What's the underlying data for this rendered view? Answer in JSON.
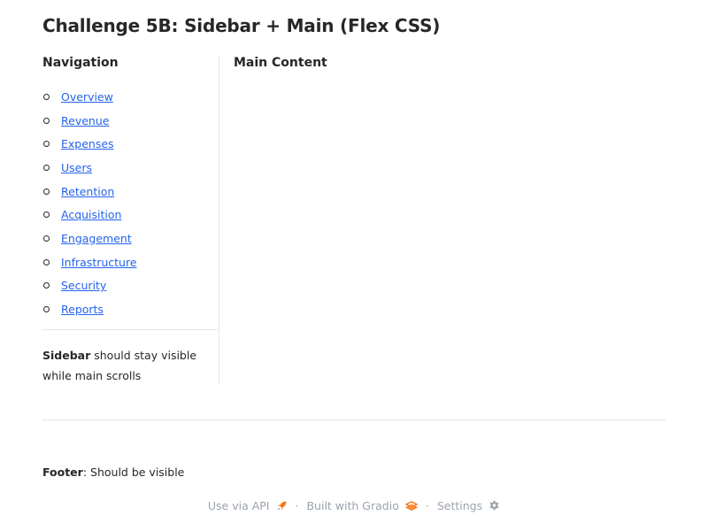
{
  "page": {
    "title": "Challenge 5B: Sidebar + Main (Flex CSS)"
  },
  "sidebar": {
    "heading": "Navigation",
    "items": [
      {
        "label": "Overview"
      },
      {
        "label": "Revenue"
      },
      {
        "label": "Expenses"
      },
      {
        "label": "Users"
      },
      {
        "label": "Retention"
      },
      {
        "label": "Acquisition"
      },
      {
        "label": "Engagement"
      },
      {
        "label": "Infrastructure"
      },
      {
        "label": "Security"
      },
      {
        "label": "Reports"
      }
    ],
    "note_bold": "Sidebar",
    "note_rest": " should stay visible while main scrolls"
  },
  "main": {
    "heading": "Main Content"
  },
  "footer": {
    "note_bold": "Footer",
    "note_rest": ": Should be visible"
  },
  "gradio_footer": {
    "api_label": "Use via API",
    "api_icon": "rocket-icon",
    "built_label": "Built with Gradio",
    "built_icon": "gradio-logo-icon",
    "settings_label": "Settings",
    "settings_icon": "gear-icon",
    "separator": "·"
  },
  "colors": {
    "link": "#2563eb",
    "muted": "#9ca3af",
    "divider": "#e5e7eb",
    "accent_orange": "#f97316"
  }
}
